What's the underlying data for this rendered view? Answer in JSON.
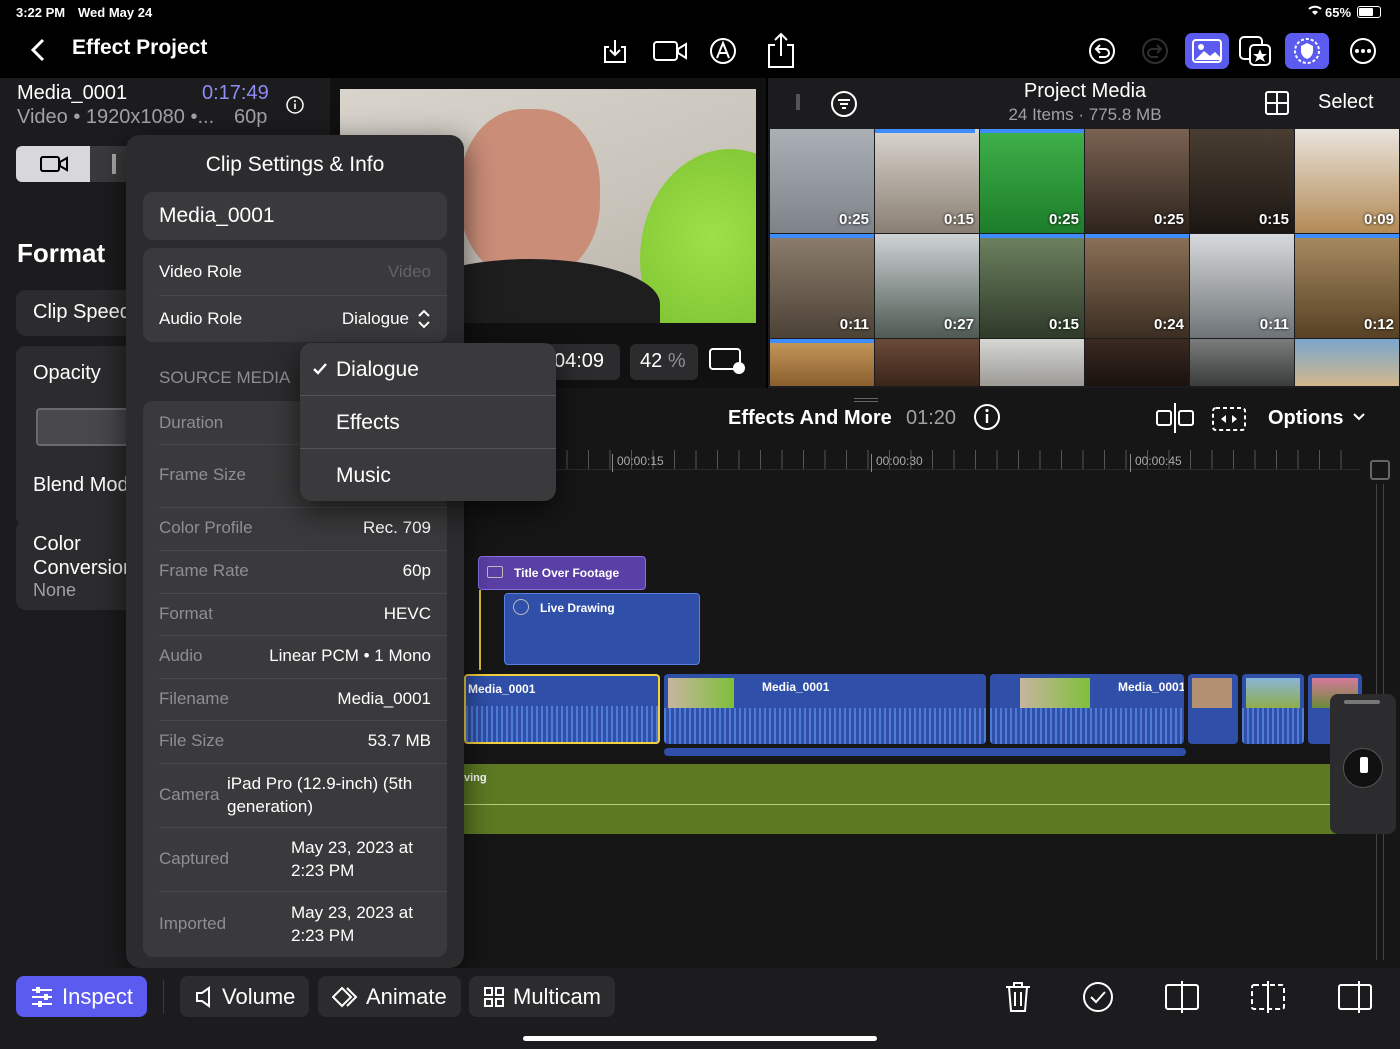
{
  "status": {
    "time": "3:22 PM",
    "date": "Wed May 24",
    "battery": "65%"
  },
  "nav": {
    "title": "Effect Project"
  },
  "clip_header": {
    "name": "Media_0001",
    "timecode": "0:17:49",
    "kind": "Video",
    "resolution": "1920x1080 •...",
    "rate": "60p"
  },
  "inspector": {
    "format_heading": "Format",
    "clip_speed": "Clip Speed",
    "opacity": "Opacity",
    "blend_mode": "Blend Mode",
    "color_conversion": "Color Conversion",
    "color_conversion_value": "None"
  },
  "popover": {
    "title": "Clip Settings & Info",
    "clip_name": "Media_0001",
    "video_role_label": "Video Role",
    "video_role_value": "Video",
    "audio_role_label": "Audio Role",
    "audio_role_value": "Dialogue",
    "section": "SOURCE MEDIA",
    "duration_label": "Duration",
    "frame_size_label": "Frame Size",
    "color_profile_label": "Color Profile",
    "color_profile_value": "Rec. 709",
    "frame_rate_label": "Frame Rate",
    "frame_rate_value": "60p",
    "format_label": "Format",
    "format_value": "HEVC",
    "audio_label": "Audio",
    "audio_value": "Linear PCM • 1 Mono",
    "filename_label": "Filename",
    "filename_value": "Media_0001",
    "file_size_label": "File Size",
    "file_size_value": "53.7 MB",
    "camera_label": "Camera",
    "camera_value": "iPad Pro (12.9-inch) (5th generation)",
    "captured_label": "Captured",
    "captured_value": "May 23, 2023 at 2:23 PM",
    "imported_label": "Imported",
    "imported_value": "May 23, 2023 at 2:23 PM"
  },
  "role_menu": {
    "items": [
      "Dialogue",
      "Effects",
      "Music"
    ],
    "selected": "Dialogue"
  },
  "viewer": {
    "timecode": "04:09",
    "zoom": "42",
    "zoom_unit": "%"
  },
  "browser": {
    "title": "Project Media",
    "items": "24 Items",
    "size": "775.8 MB",
    "select": "Select",
    "durations": [
      "0:25",
      "0:15",
      "0:25",
      "0:25",
      "0:15",
      "0:09",
      "0:11",
      "0:27",
      "0:15",
      "0:24",
      "0:11",
      "0:12"
    ]
  },
  "timeline": {
    "project": "Effects And More",
    "duration": "01:20",
    "options": "Options",
    "ticks": [
      "00:00:15",
      "00:00:30",
      "00:00:45"
    ],
    "clips": {
      "title": "Title Over Footage",
      "drawing": "Live Drawing",
      "media1": "Media_0001",
      "media2": "Media_0001",
      "media3": "Media_0001",
      "audio": "ving"
    }
  },
  "toolbar": {
    "inspect": "Inspect",
    "volume": "Volume",
    "animate": "Animate",
    "multicam": "Multicam"
  },
  "colors": {
    "accent": "#5b5bf0",
    "timeline_clip": "#2f4fa8",
    "title_clip": "#5a3fa6",
    "audio_track": "#5d7a23"
  }
}
